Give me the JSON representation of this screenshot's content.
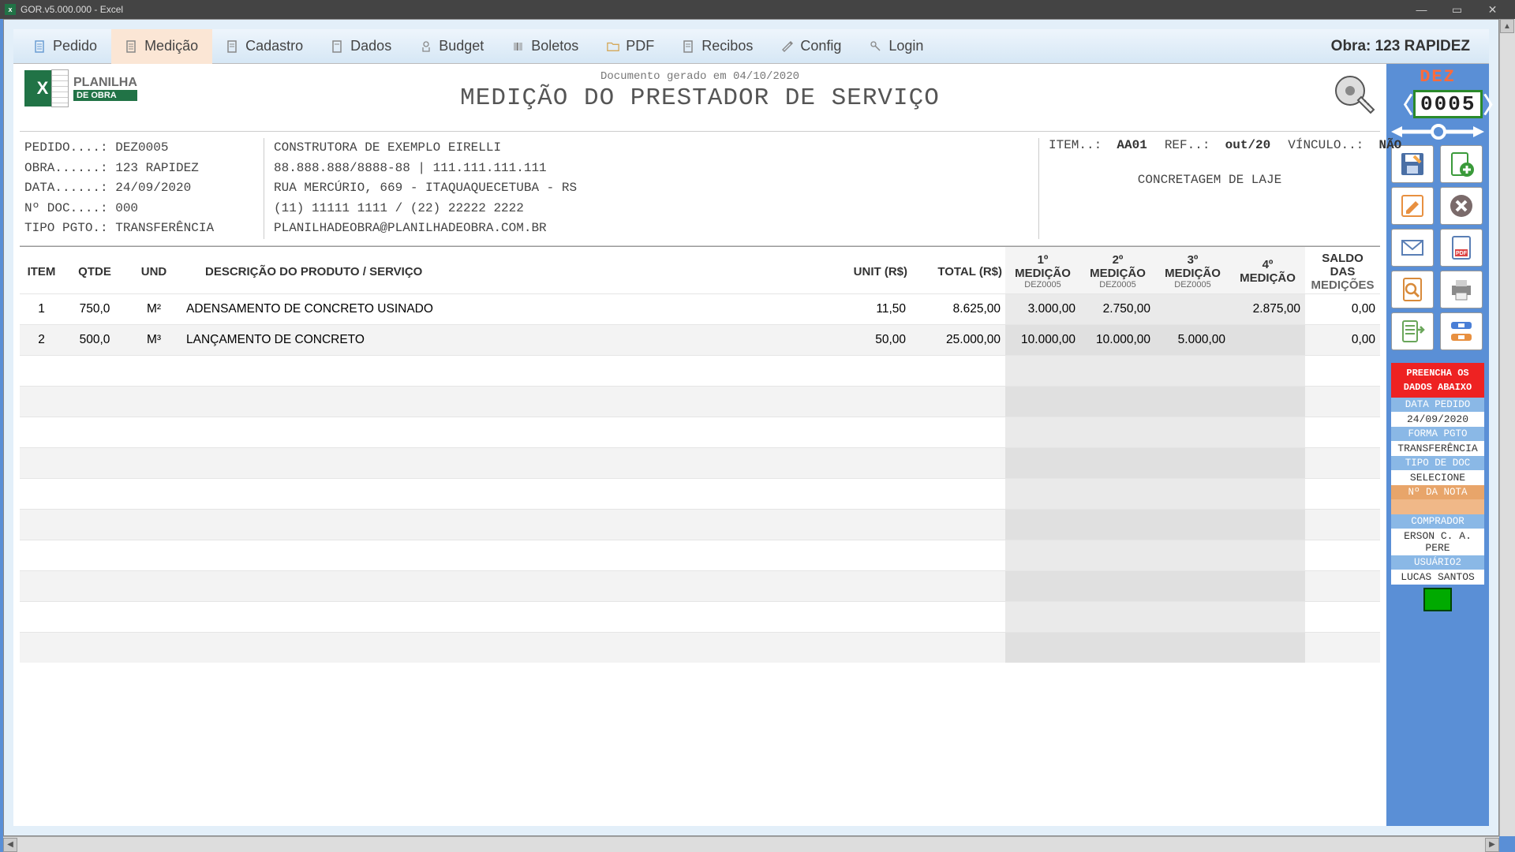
{
  "window": {
    "title": "GOR.v5.000.000 - Excel"
  },
  "tabs": [
    {
      "label": "Pedido"
    },
    {
      "label": "Medição"
    },
    {
      "label": "Cadastro"
    },
    {
      "label": "Dados"
    },
    {
      "label": "Budget"
    },
    {
      "label": "Boletos"
    },
    {
      "label": "PDF"
    },
    {
      "label": "Recibos"
    },
    {
      "label": "Config"
    },
    {
      "label": "Login"
    }
  ],
  "obra_label": "Obra: 123 RAPIDEZ",
  "logo": {
    "line1": "PLANILHA",
    "line2": "DE OBRA",
    "xl": "X"
  },
  "doc": {
    "generated": "Documento gerado em 04/10/2020",
    "title": "MEDIÇÃO DO PRESTADOR DE SERVIÇO"
  },
  "info": {
    "pedido": "PEDIDO....: DEZ0005",
    "obra": "OBRA......: 123 RAPIDEZ",
    "data": "DATA......: 24/09/2020",
    "doc": "Nº DOC....: 000",
    "pgto": "TIPO PGTO.: TRANSFERÊNCIA",
    "company": "CONSTRUTORA DE EXEMPLO EIRELLI",
    "cnpj": "88.888.888/8888-88 | 111.111.111.111",
    "address": "RUA MERCÚRIO, 669 - ITAQUAQUECETUBA - RS",
    "phones": "(11) 11111 1111 / (22) 22222 2222",
    "email": "PLANILHADEOBRA@PLANILHADEOBRA.COM.BR",
    "item_l": "ITEM..:",
    "item_v": "AA01",
    "ref_l": "REF..:",
    "ref_v": "out/20",
    "vinc_l": "VÍNCULO..:",
    "vinc_v": "NÃO",
    "task": "CONCRETAGEM DE LAJE"
  },
  "columns": {
    "item": "ITEM",
    "qtde": "QTDE",
    "und": "UND",
    "desc": "DESCRIÇÃO DO PRODUTO / SERVIÇO",
    "unit": "UNIT (R$)",
    "total": "TOTAL (R$)",
    "m1": "1º MEDIÇÃO",
    "m1s": "DEZ0005",
    "m2": "2º MEDIÇÃO",
    "m2s": "DEZ0005",
    "m3": "3º MEDIÇÃO",
    "m3s": "DEZ0005",
    "m4": "4º MEDIÇÃO",
    "m4s": "",
    "saldo": "SALDO DAS",
    "saldo2": "MEDIÇÕES"
  },
  "rows": [
    {
      "item": "1",
      "qtde": "750,0",
      "und": "M²",
      "desc": "ADENSAMENTO DE CONCRETO USINADO",
      "unit": "11,50",
      "total": "8.625,00",
      "m1": "3.000,00",
      "m2": "2.750,00",
      "m3": "",
      "m4": "2.875,00",
      "saldo": "0,00"
    },
    {
      "item": "2",
      "qtde": "500,0",
      "und": "M³",
      "desc": "LANÇAMENTO DE CONCRETO",
      "unit": "50,00",
      "total": "25.000,00",
      "m1": "10.000,00",
      "m2": "10.000,00",
      "m3": "5.000,00",
      "m4": "",
      "saldo": "0,00"
    }
  ],
  "sidebar": {
    "month": "DEZ",
    "counter": "0005",
    "warn": "PREENCHA OS\nDADOS ABAIXO",
    "f": {
      "data_l": "DATA PEDIDO",
      "data_v": "24/09/2020",
      "forma_l": "FORMA PGTO",
      "forma_v": "TRANSFERÊNCIA",
      "tipo_l": "TIPO DE DOC",
      "tipo_v": "SELECIONE",
      "nota_l": "Nº DA NOTA",
      "nota_v": "",
      "comp_l": "COMPRADOR",
      "comp_v": "ERSON C. A. PERE",
      "user_l": "USUÁRIO2",
      "user_v": "LUCAS SANTOS"
    }
  }
}
